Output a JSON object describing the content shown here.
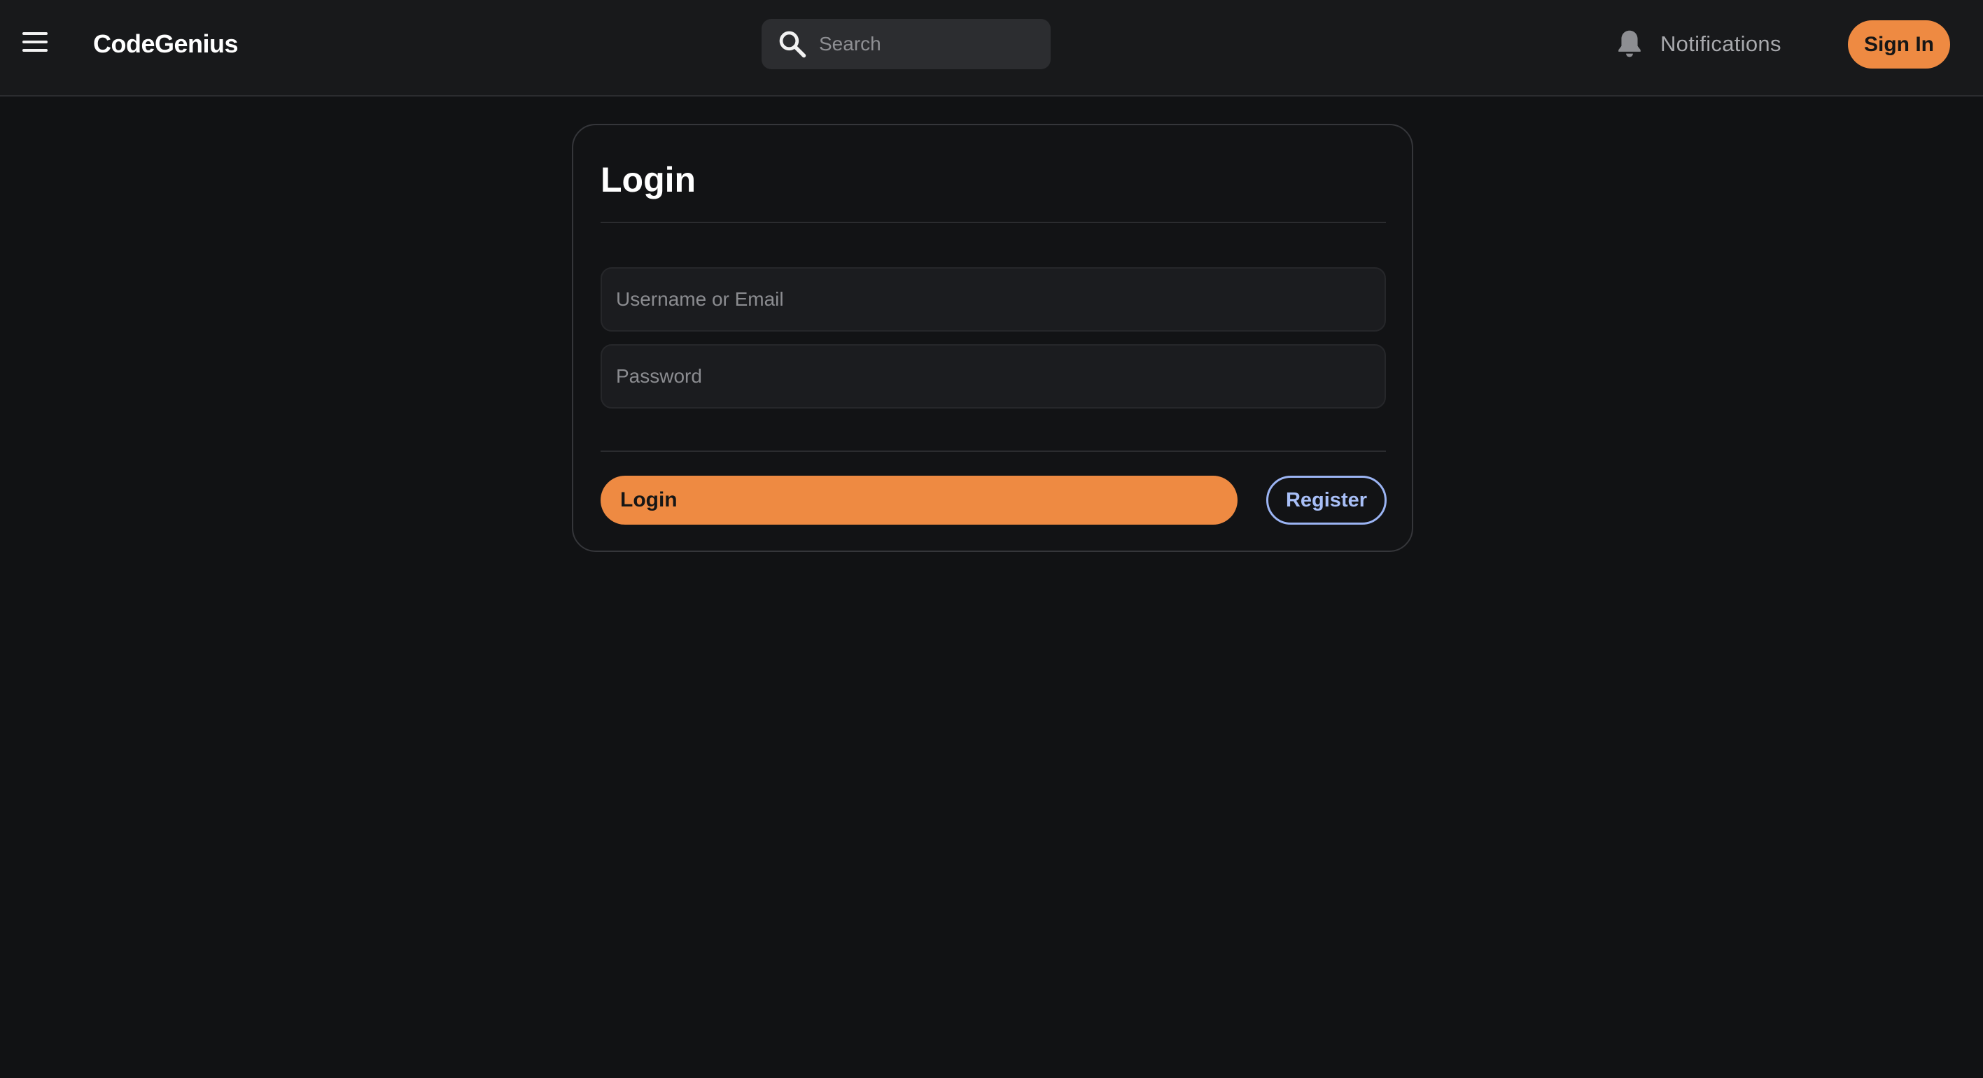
{
  "header": {
    "menu_icon": "hamburger-menu-icon",
    "brand": "CodeGenius",
    "search": {
      "icon": "search-icon",
      "placeholder": "Search",
      "value": ""
    },
    "notifications": {
      "icon": "bell-icon",
      "label": "Notifications"
    },
    "sign_in_label": "Sign In"
  },
  "login_card": {
    "title": "Login",
    "username_field": {
      "placeholder": "Username or Email",
      "value": ""
    },
    "password_field": {
      "placeholder": "Password",
      "value": ""
    },
    "login_label": "Login",
    "register_label": "Register"
  },
  "colors": {
    "background": "#111214",
    "header_background": "#18191b",
    "accent_orange": "#ee8a42",
    "register_blue": "#9bb4f3"
  }
}
